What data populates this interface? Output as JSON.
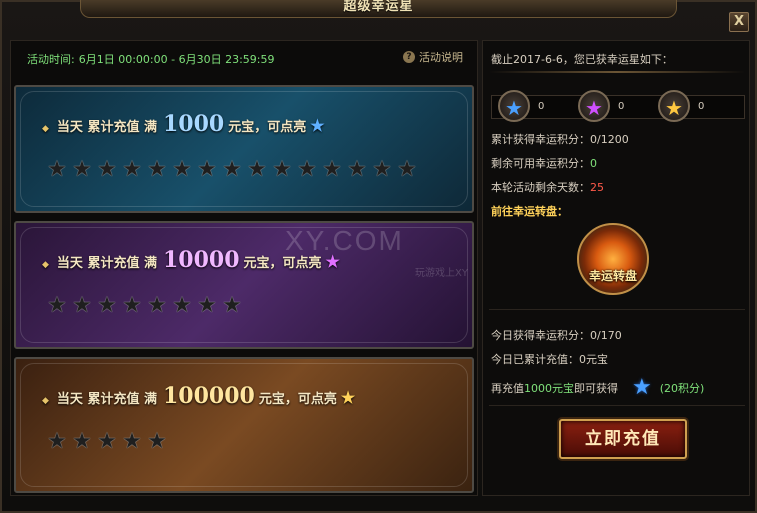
{
  "window": {
    "title": "超级幸运星",
    "close_label": "X"
  },
  "event": {
    "time_label": "活动时间:",
    "time_value": "6月1日 00:00:00 - 6月30日 23:59:59",
    "help_label": "活动说明",
    "help_icon": "?"
  },
  "tiers": [
    {
      "prefix": "当天 累计充值 满",
      "amount": "1000",
      "suffix": "元宝，可点亮",
      "star_color": "#5fb0ff",
      "star_slots": 15
    },
    {
      "prefix": "当天 累计充值 满",
      "amount": "10000",
      "suffix": "元宝，可点亮",
      "star_color": "#e070ff",
      "star_slots": 8
    },
    {
      "prefix": "当天 累计充值 满",
      "amount": "100000",
      "suffix": "元宝，可点亮",
      "star_color": "#ffd25a",
      "star_slots": 5
    }
  ],
  "watermark": {
    "main": "XY.COM",
    "sub": "玩游戏上XY"
  },
  "summary": {
    "header": "截止2017-6-6，您已获幸运星如下：",
    "counts": {
      "blue": "0",
      "purple": "0",
      "gold": "0"
    },
    "total_points_label": "累计获得幸运积分：",
    "total_points_value": "0/1200",
    "remaining_points_label": "剩余可用幸运积分：",
    "remaining_points_value": "0",
    "days_left_label": "本轮活动剩余天数：",
    "days_left_value": "25",
    "wheel_link": "前往幸运转盘：",
    "wheel_label": "幸运转盘",
    "today_points_label": "今日获得幸运积分：",
    "today_points_value": "0/170",
    "today_recharge_label": "今日已累计充值：",
    "today_recharge_value": "0元宝",
    "next_prefix": "再充值",
    "next_amount": "1000元宝",
    "next_suffix": "即可获得",
    "next_points": "(20积分)",
    "recharge_button": "立即充值"
  },
  "colors": {
    "green_text": "#7fe07a",
    "red_text": "#ff5a4a",
    "gold_text": "#ffd25a"
  }
}
